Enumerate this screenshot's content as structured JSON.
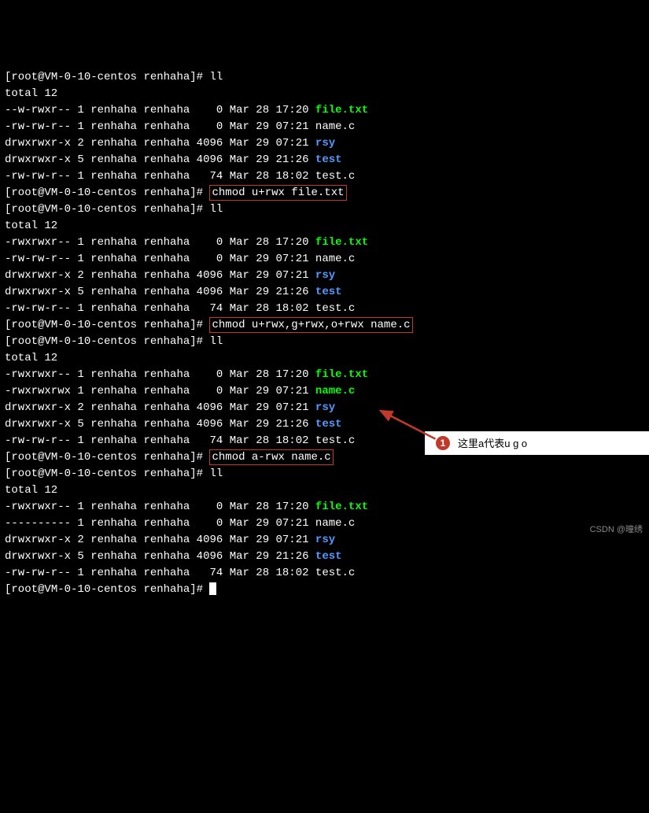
{
  "prompt": {
    "user": "root",
    "host": "VM-0-10-centos",
    "dir": "renhaha",
    "symbol": "#"
  },
  "commands": {
    "ll": "ll",
    "chmod1": "chmod u+rwx file.txt",
    "chmod2": "chmod u+rwx,g+rwx,o+rwx name.c",
    "chmod3": "chmod a-rwx name.c"
  },
  "total": "total 12",
  "listings": {
    "l1": [
      {
        "perms": "--w-rwxr--",
        "links": "1",
        "owner": "renhaha",
        "group": "renhaha",
        "size": "   0",
        "date": "Mar 28 17:20",
        "name": "file.txt",
        "color": "green"
      },
      {
        "perms": "-rw-rw-r--",
        "links": "1",
        "owner": "renhaha",
        "group": "renhaha",
        "size": "   0",
        "date": "Mar 29 07:21",
        "name": "name.c",
        "color": "white"
      },
      {
        "perms": "drwxrwxr-x",
        "links": "2",
        "owner": "renhaha",
        "group": "renhaha",
        "size": "4096",
        "date": "Mar 29 07:21",
        "name": "rsy",
        "color": "blue"
      },
      {
        "perms": "drwxrwxr-x",
        "links": "5",
        "owner": "renhaha",
        "group": "renhaha",
        "size": "4096",
        "date": "Mar 29 21:26",
        "name": "test",
        "color": "blue"
      },
      {
        "perms": "-rw-rw-r--",
        "links": "1",
        "owner": "renhaha",
        "group": "renhaha",
        "size": "  74",
        "date": "Mar 28 18:02",
        "name": "test.c",
        "color": "white"
      }
    ],
    "l2": [
      {
        "perms": "-rwxrwxr--",
        "links": "1",
        "owner": "renhaha",
        "group": "renhaha",
        "size": "   0",
        "date": "Mar 28 17:20",
        "name": "file.txt",
        "color": "green"
      },
      {
        "perms": "-rw-rw-r--",
        "links": "1",
        "owner": "renhaha",
        "group": "renhaha",
        "size": "   0",
        "date": "Mar 29 07:21",
        "name": "name.c",
        "color": "white"
      },
      {
        "perms": "drwxrwxr-x",
        "links": "2",
        "owner": "renhaha",
        "group": "renhaha",
        "size": "4096",
        "date": "Mar 29 07:21",
        "name": "rsy",
        "color": "blue"
      },
      {
        "perms": "drwxrwxr-x",
        "links": "5",
        "owner": "renhaha",
        "group": "renhaha",
        "size": "4096",
        "date": "Mar 29 21:26",
        "name": "test",
        "color": "blue"
      },
      {
        "perms": "-rw-rw-r--",
        "links": "1",
        "owner": "renhaha",
        "group": "renhaha",
        "size": "  74",
        "date": "Mar 28 18:02",
        "name": "test.c",
        "color": "white"
      }
    ],
    "l3": [
      {
        "perms": "-rwxrwxr--",
        "links": "1",
        "owner": "renhaha",
        "group": "renhaha",
        "size": "   0",
        "date": "Mar 28 17:20",
        "name": "file.txt",
        "color": "green"
      },
      {
        "perms": "-rwxrwxrwx",
        "links": "1",
        "owner": "renhaha",
        "group": "renhaha",
        "size": "   0",
        "date": "Mar 29 07:21",
        "name": "name.c",
        "color": "green"
      },
      {
        "perms": "drwxrwxr-x",
        "links": "2",
        "owner": "renhaha",
        "group": "renhaha",
        "size": "4096",
        "date": "Mar 29 07:21",
        "name": "rsy",
        "color": "blue"
      },
      {
        "perms": "drwxrwxr-x",
        "links": "5",
        "owner": "renhaha",
        "group": "renhaha",
        "size": "4096",
        "date": "Mar 29 21:26",
        "name": "test",
        "color": "blue"
      },
      {
        "perms": "-rw-rw-r--",
        "links": "1",
        "owner": "renhaha",
        "group": "renhaha",
        "size": "  74",
        "date": "Mar 28 18:02",
        "name": "test.c",
        "color": "white"
      }
    ],
    "l4": [
      {
        "perms": "-rwxrwxr--",
        "links": "1",
        "owner": "renhaha",
        "group": "renhaha",
        "size": "   0",
        "date": "Mar 28 17:20",
        "name": "file.txt",
        "color": "green"
      },
      {
        "perms": "----------",
        "links": "1",
        "owner": "renhaha",
        "group": "renhaha",
        "size": "   0",
        "date": "Mar 29 07:21",
        "name": "name.c",
        "color": "white"
      },
      {
        "perms": "drwxrwxr-x",
        "links": "2",
        "owner": "renhaha",
        "group": "renhaha",
        "size": "4096",
        "date": "Mar 29 07:21",
        "name": "rsy",
        "color": "blue"
      },
      {
        "perms": "drwxrwxr-x",
        "links": "5",
        "owner": "renhaha",
        "group": "renhaha",
        "size": "4096",
        "date": "Mar 29 21:26",
        "name": "test",
        "color": "blue"
      },
      {
        "perms": "-rw-rw-r--",
        "links": "1",
        "owner": "renhaha",
        "group": "renhaha",
        "size": "  74",
        "date": "Mar 28 18:02",
        "name": "test.c",
        "color": "white"
      }
    ]
  },
  "annotation": {
    "num": "1",
    "text": "这里a代表u g o"
  },
  "watermark": "CSDN @曈绣"
}
